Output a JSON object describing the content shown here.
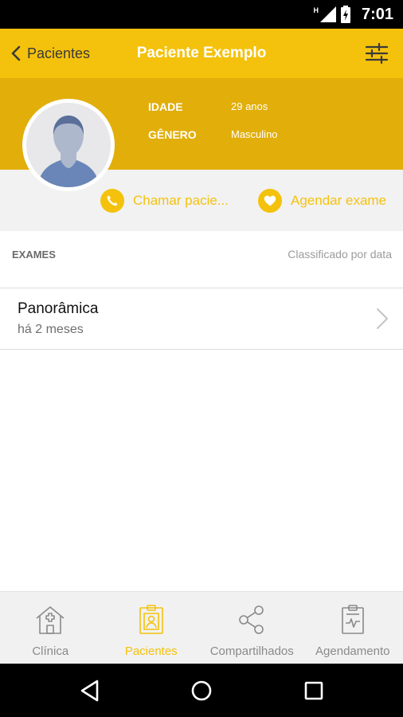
{
  "status_bar": {
    "time": "7:01",
    "network_label": "H"
  },
  "header": {
    "back_label": "Pacientes",
    "title": "Paciente Exemplo"
  },
  "patient": {
    "age_label": "IDADE",
    "age_value": "29 anos",
    "gender_label": "GÊNERO",
    "gender_value": "Masculino"
  },
  "actions": {
    "call_label": "Chamar pacie...",
    "schedule_label": "Agendar exame"
  },
  "exams_section": {
    "title": "EXAMES",
    "sort_label": "Classificado por data"
  },
  "exams": [
    {
      "name": "Panorâmica",
      "date": "há 2 meses"
    }
  ],
  "tabs": [
    {
      "label": "Clínica",
      "icon": "clinic-icon",
      "active": false
    },
    {
      "label": "Pacientes",
      "icon": "patients-icon",
      "active": true
    },
    {
      "label": "Compartilhados",
      "icon": "share-icon",
      "active": false
    },
    {
      "label": "Agendamento",
      "icon": "schedule-icon",
      "active": false
    }
  ],
  "colors": {
    "accent": "#f4c20d",
    "profile_bg": "#e2ae0a",
    "action_bg": "#f2f2f2",
    "tab_bar_bg": "#f1f1f1"
  }
}
